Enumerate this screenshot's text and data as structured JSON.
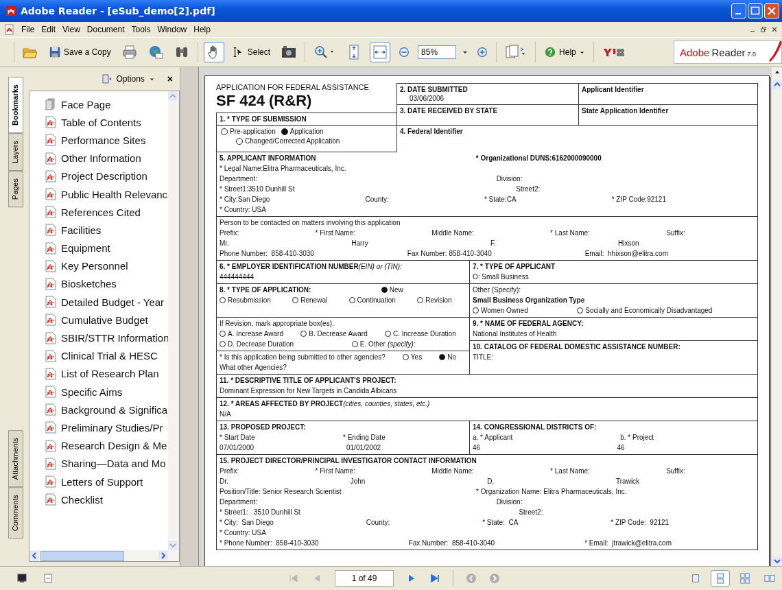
{
  "window": {
    "title": "Adobe Reader - [eSub_demo[2].pdf]"
  },
  "menu": [
    "File",
    "Edit",
    "View",
    "Document",
    "Tools",
    "Window",
    "Help"
  ],
  "toolbar": {
    "save_copy": {
      "label": "Save a Copy"
    },
    "hand": {
      "pressed": true
    },
    "select": {
      "label": "Select",
      "pressed": false
    },
    "fit_page": {
      "pressed": false
    },
    "fit_width": {
      "pressed": true
    },
    "zoom": {
      "value": "85%"
    },
    "help": {
      "label": "Help"
    },
    "brand": {
      "name": "Adobe",
      "product": "Reader",
      "version": "7.0"
    }
  },
  "side_tabs": [
    {
      "label": "Bookmarks",
      "selected": true
    },
    {
      "label": "Layers",
      "selected": false
    },
    {
      "label": "Pages",
      "selected": false
    },
    {
      "label": "Attachments",
      "selected": false
    },
    {
      "label": "Comments",
      "selected": false
    }
  ],
  "panel": {
    "options": "Options",
    "close": "×"
  },
  "bookmarks": [
    {
      "label": "Face Page",
      "kind": "page"
    },
    {
      "label": "Table of Contents",
      "kind": "pdf"
    },
    {
      "label": "Performance Sites",
      "kind": "pdf"
    },
    {
      "label": "Other Information",
      "kind": "pdf"
    },
    {
      "label": "Project Description",
      "kind": "pdf"
    },
    {
      "label": "Public Health Relevanc",
      "kind": "pdf"
    },
    {
      "label": "References Cited",
      "kind": "pdf"
    },
    {
      "label": "Facilities",
      "kind": "pdf"
    },
    {
      "label": "Equipment",
      "kind": "pdf"
    },
    {
      "label": "Key Personnel",
      "kind": "pdf"
    },
    {
      "label": "Biosketches",
      "kind": "pdf"
    },
    {
      "label": "Detailed Budget - Year",
      "kind": "pdf"
    },
    {
      "label": "Cumulative Budget",
      "kind": "pdf"
    },
    {
      "label": "SBIR/STTR Information",
      "kind": "pdf"
    },
    {
      "label": "Clinical Trial & HESC",
      "kind": "pdf"
    },
    {
      "label": "List of Research Plan",
      "kind": "pdf"
    },
    {
      "label": "Specific Aims",
      "kind": "pdf"
    },
    {
      "label": "Background & Significa",
      "kind": "pdf"
    },
    {
      "label": "Preliminary Studies/Pr",
      "kind": "pdf"
    },
    {
      "label": "Research Design & Me",
      "kind": "pdf"
    },
    {
      "label": "Sharing—Data and Mo",
      "kind": "pdf"
    },
    {
      "label": "Letters of Support",
      "kind": "pdf"
    },
    {
      "label": "Checklist",
      "kind": "pdf"
    }
  ],
  "form": {
    "subtitle": "APPLICATION FOR FEDERAL ASSISTANCE",
    "title": "SF 424 (R&R)",
    "submission": {
      "heading": "1. * TYPE OF SUBMISSION",
      "options": [
        {
          "label": "Pre-application",
          "checked": false
        },
        {
          "label": "Application",
          "checked": true
        },
        {
          "label": "Changed/Corrected Application",
          "checked": false
        }
      ]
    },
    "date_submitted": {
      "heading": "2. DATE SUBMITTED",
      "value": "03/06/2006"
    },
    "applicant_identifier": "Applicant Identifier",
    "date_received": "3. DATE RECEIVED BY STATE",
    "state_identifier": "State Application Identifier",
    "federal_identifier": "4. Federal Identifier",
    "sections": [
      {
        "cells": [
          {
            "blocks": [
              [
                [
                  {
                    "kind": "heading",
                    "t": "5. APPLICANT INFORMATION"
                  },
                  {
                    "kind": "heading",
                    "t": "* Organizational DUNS:6162000090000"
                  }
                ],
                [
                  {
                    "kind": "text",
                    "t": "* Legal Name:Elitra Pharmaceuticals, Inc."
                  }
                ],
                [
                  {
                    "kind": "text",
                    "t": "Department:"
                  },
                  {
                    "kind": "text",
                    "t": "Division:"
                  }
                ],
                [
                  {
                    "kind": "text",
                    "t": "* Street1:3510 Dunhill St"
                  },
                  {
                    "kind": "text",
                    "t": "Street2:"
                  }
                ],
                [
                  {
                    "kind": "text",
                    "t": "* City:San Diego"
                  },
                  {
                    "kind": "text",
                    "t": "County:"
                  },
                  {
                    "kind": "text",
                    "t": "* State:CA"
                  },
                  {
                    "kind": "text",
                    "t": "* ZIP Code:92121"
                  }
                ],
                [
                  {
                    "kind": "text",
                    "t": "* Country: USA"
                  }
                ]
              ]
            ]
          }
        ]
      },
      {
        "cells": [
          {
            "blocks": [
              [
                [
                  {
                    "kind": "text",
                    "t": "Person to be contacted on matters involving this application"
                  }
                ],
                [
                  {
                    "kind": "text",
                    "t": "Prefix:"
                  },
                  {
                    "kind": "text",
                    "t": "* First Name:"
                  },
                  {
                    "kind": "text",
                    "t": "Middle Name:"
                  },
                  {
                    "kind": "text",
                    "t": "* Last Name:"
                  },
                  {
                    "kind": "text",
                    "t": "Suffix:"
                  }
                ],
                [
                  {
                    "kind": "text",
                    "t": "Mr."
                  },
                  {
                    "kind": "text",
                    "t": "Harry"
                  },
                  {
                    "kind": "text",
                    "t": "F."
                  },
                  {
                    "kind": "text",
                    "t": "Hixson"
                  }
                ],
                [
                  {
                    "kind": "text",
                    "t": "Phone Number:  858-410-3030"
                  },
                  {
                    "kind": "text",
                    "t": "Fax Number: 858-410-3040"
                  },
                  {
                    "kind": "text",
                    "t": "Email:  hhixson@elitra.com"
                  }
                ]
              ]
            ]
          }
        ]
      },
      {
        "cells": [
          {
            "blocks": [
              [
                [
                  {
                    "kind": "heading",
                    "t": "6. * EMPLOYER IDENTIFICATION NUMBER",
                    "note": "(EIN) or (TIN):"
                  }
                ],
                [
                  {
                    "kind": "text",
                    "t": "444444444"
                  }
                ]
              ]
            ]
          },
          {
            "blocks": [
              [
                [
                  {
                    "kind": "heading",
                    "t": "7. * TYPE OF APPLICANT"
                  }
                ],
                [
                  {
                    "kind": "text",
                    "t": "O: Small Business"
                  }
                ]
              ]
            ]
          }
        ]
      },
      {
        "cells": [
          {
            "blocks": [
              [
                [
                  {
                    "kind": "heading",
                    "t": "8. * TYPE OF APPLICATION:"
                  },
                  {
                    "kind": "radio",
                    "t": "New",
                    "checked": true
                  }
                ],
                [
                  {
                    "kind": "radio",
                    "t": "Resubmission",
                    "checked": false
                  },
                  {
                    "kind": "radio",
                    "t": "Renewal",
                    "checked": false
                  },
                  {
                    "kind": "radio",
                    "t": "Continuation",
                    "checked": false
                  },
                  {
                    "kind": "radio",
                    "t": "Revision",
                    "checked": false
                  }
                ]
              ]
            ]
          },
          {
            "blocks": [
              [
                [
                  {
                    "kind": "text",
                    "t": "Other (Specify):"
                  }
                ],
                [
                  {
                    "kind": "heading",
                    "t": "Small Business Organization Type"
                  }
                ],
                [
                  {
                    "kind": "radio",
                    "t": "Women Owned",
                    "checked": false
                  },
                  {
                    "kind": "radio",
                    "t": "Socially and Economically Disadvantaged",
                    "checked": false
                  }
                ]
              ]
            ]
          }
        ]
      },
      {
        "cells": [
          {
            "blocks": [
              [
                [
                  {
                    "kind": "text",
                    "t": "If Revision, mark appropriate box(es)."
                  }
                ],
                [
                  {
                    "kind": "radio",
                    "t": "A. Increase Award",
                    "checked": false
                  },
                  {
                    "kind": "radio",
                    "t": "B. Decrease Award",
                    "checked": false
                  },
                  {
                    "kind": "radio",
                    "t": "C. Increase Duration",
                    "checked": false
                  }
                ],
                [
                  {
                    "kind": "radio",
                    "t": "D. Decrease Duration",
                    "checked": false
                  },
                  {
                    "kind": "radio",
                    "t": "E. Other",
                    "note": "(specify):",
                    "checked": false
                  }
                ]
              ],
              [
                [
                  {
                    "kind": "text",
                    "t": "* Is this application being submitted to other agencies?"
                  },
                  {
                    "kind": "radio",
                    "t": "Yes",
                    "checked": false
                  },
                  {
                    "kind": "radio",
                    "t": "No",
                    "checked": true
                  }
                ],
                [
                  {
                    "kind": "text",
                    "t": "What other Agencies?"
                  }
                ]
              ]
            ]
          },
          {
            "blocks": [
              [
                [
                  {
                    "kind": "heading",
                    "t": "9. * NAME OF FEDERAL AGENCY:"
                  }
                ],
                [
                  {
                    "kind": "text",
                    "t": "National Institutes of Health"
                  }
                ]
              ],
              [
                [
                  {
                    "kind": "heading",
                    "t": "10. CATALOG OF FEDERAL DOMESTIC ASSISTANCE NUMBER:"
                  }
                ],
                [
                  {
                    "kind": "text",
                    "t": "TITLE:"
                  }
                ]
              ]
            ]
          }
        ]
      },
      {
        "cells": [
          {
            "blocks": [
              [
                [
                  {
                    "kind": "heading",
                    "t": "11. * DESCRIPTIVE TITLE OF APPLICANT'S PROJECT:"
                  }
                ],
                [
                  {
                    "kind": "text",
                    "t": "Dominant Expression for New Targets in Candida Albicans"
                  }
                ]
              ]
            ]
          }
        ]
      },
      {
        "cells": [
          {
            "blocks": [
              [
                [
                  {
                    "kind": "heading",
                    "t": "12. * AREAS AFFECTED BY PROJECT",
                    "note": "(cities, counties, states, etc.)"
                  }
                ],
                [
                  {
                    "kind": "text",
                    "t": "N/A"
                  }
                ]
              ]
            ]
          }
        ]
      },
      {
        "cells": [
          {
            "blocks": [
              [
                [
                  {
                    "kind": "heading",
                    "t": "13. PROPOSED PROJECT:"
                  }
                ],
                [
                  {
                    "kind": "text",
                    "t": "* Start Date"
                  },
                  {
                    "kind": "text",
                    "t": "* Ending Date"
                  }
                ],
                [
                  {
                    "kind": "text",
                    "t": "07/01/2000"
                  },
                  {
                    "kind": "text",
                    "t": "01/01/2002"
                  }
                ]
              ]
            ]
          },
          {
            "blocks": [
              [
                [
                  {
                    "kind": "heading",
                    "t": "14. CONGRESSIONAL DISTRICTS OF:"
                  }
                ],
                [
                  {
                    "kind": "text",
                    "t": "a. * Applicant"
                  },
                  {
                    "kind": "text",
                    "t": "b. * Project"
                  }
                ],
                [
                  {
                    "kind": "text",
                    "t": "46"
                  },
                  {
                    "kind": "text",
                    "t": "46"
                  }
                ]
              ]
            ]
          }
        ]
      },
      {
        "cells": [
          {
            "blocks": [
              [
                [
                  {
                    "kind": "heading",
                    "t": "15. PROJECT DIRECTOR/PRINCIPAL INVESTIGATOR CONTACT INFORMATION"
                  }
                ],
                [
                  {
                    "kind": "text",
                    "t": "Prefix:"
                  },
                  {
                    "kind": "text",
                    "t": "* First Name:"
                  },
                  {
                    "kind": "text",
                    "t": "Middle Name:"
                  },
                  {
                    "kind": "text",
                    "t": "* Last Name:"
                  },
                  {
                    "kind": "text",
                    "t": "Suffix:"
                  }
                ],
                [
                  {
                    "kind": "text",
                    "t": "Dr."
                  },
                  {
                    "kind": "text",
                    "t": "John"
                  },
                  {
                    "kind": "text",
                    "t": "D."
                  },
                  {
                    "kind": "text",
                    "t": "Trawick"
                  }
                ],
                [
                  {
                    "kind": "text",
                    "t": "Position/Title: Senior Research Scientist"
                  },
                  {
                    "kind": "text",
                    "t": "* Organization Name: Elitra Pharmaceuticals, Inc."
                  }
                ],
                [
                  {
                    "kind": "text",
                    "t": "Department:"
                  },
                  {
                    "kind": "text",
                    "t": "Division:"
                  }
                ],
                [
                  {
                    "kind": "text",
                    "t": "* Street1:   3510 Dunhill St"
                  },
                  {
                    "kind": "text",
                    "t": "Street2:"
                  }
                ],
                [
                  {
                    "kind": "text",
                    "t": "* City:  San Diego"
                  },
                  {
                    "kind": "text",
                    "t": "County:"
                  },
                  {
                    "kind": "text",
                    "t": "* State:  CA"
                  },
                  {
                    "kind": "text",
                    "t": "* ZIP Code:  92121"
                  }
                ],
                [
                  {
                    "kind": "text",
                    "t": "* Country: USA"
                  }
                ],
                [
                  {
                    "kind": "text",
                    "t": "* Phone Number:  858-410-3030"
                  },
                  {
                    "kind": "text",
                    "t": "Fax Number:  858-410-3040"
                  },
                  {
                    "kind": "text",
                    "t": "* Email:  jtrawick@elitra.com"
                  }
                ]
              ]
            ]
          }
        ]
      }
    ]
  },
  "status": {
    "page": "1 of 49",
    "nav": [
      {
        "disabled": true
      },
      {
        "disabled": true
      },
      {
        "disabled": false
      },
      {
        "disabled": false
      }
    ],
    "history": [
      {
        "disabled": true
      },
      {
        "disabled": true
      }
    ],
    "layouts": [
      {
        "selected": false
      },
      {
        "selected": true
      },
      {
        "selected": false
      },
      {
        "selected": false
      }
    ]
  }
}
